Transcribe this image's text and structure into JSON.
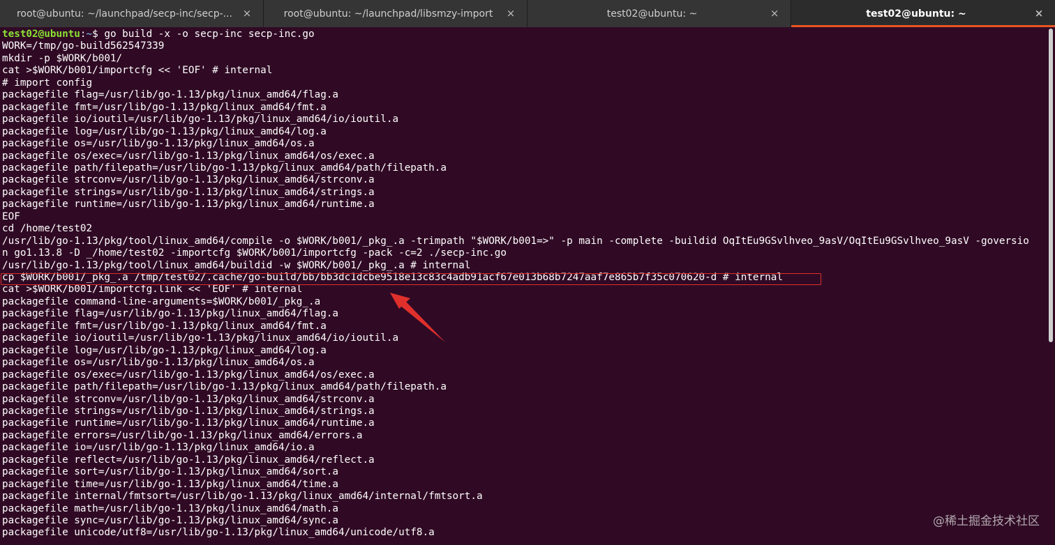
{
  "tabs": [
    {
      "title": "root@ubuntu: ~/launchpad/secp-inc/secp-...",
      "close": "×",
      "active": false
    },
    {
      "title": "root@ubuntu: ~/launchpad/libsmzy-import",
      "close": "×",
      "active": false
    },
    {
      "title": "test02@ubuntu: ~",
      "close": "×",
      "active": false
    },
    {
      "title": "test02@ubuntu: ~",
      "close": "×",
      "active": true
    }
  ],
  "terminal": {
    "prompt_user": "test02@ubuntu",
    "prompt_sep": ":",
    "prompt_path": "~",
    "prompt_symbol": "$ ",
    "command": "go build -x -o secp-inc secp-inc.go",
    "lines": [
      "WORK=/tmp/go-build562547339",
      "mkdir -p $WORK/b001/",
      "cat >$WORK/b001/importcfg << 'EOF' # internal",
      "# import config",
      "packagefile flag=/usr/lib/go-1.13/pkg/linux_amd64/flag.a",
      "packagefile fmt=/usr/lib/go-1.13/pkg/linux_amd64/fmt.a",
      "packagefile io/ioutil=/usr/lib/go-1.13/pkg/linux_amd64/io/ioutil.a",
      "packagefile log=/usr/lib/go-1.13/pkg/linux_amd64/log.a",
      "packagefile os=/usr/lib/go-1.13/pkg/linux_amd64/os.a",
      "packagefile os/exec=/usr/lib/go-1.13/pkg/linux_amd64/os/exec.a",
      "packagefile path/filepath=/usr/lib/go-1.13/pkg/linux_amd64/path/filepath.a",
      "packagefile strconv=/usr/lib/go-1.13/pkg/linux_amd64/strconv.a",
      "packagefile strings=/usr/lib/go-1.13/pkg/linux_amd64/strings.a",
      "packagefile runtime=/usr/lib/go-1.13/pkg/linux_amd64/runtime.a",
      "EOF",
      "cd /home/test02",
      "/usr/lib/go-1.13/pkg/tool/linux_amd64/compile -o $WORK/b001/_pkg_.a -trimpath \"$WORK/b001=>\" -p main -complete -buildid OqItEu9GSvlhveo_9asV/OqItEu9GSvlhveo_9asV -goversio",
      "n go1.13.8 -D _/home/test02 -importcfg $WORK/b001/importcfg -pack -c=2 ./secp-inc.go",
      "/usr/lib/go-1.13/pkg/tool/linux_amd64/buildid -w $WORK/b001/_pkg_.a # internal",
      "cp $WORK/b001/_pkg_.a /tmp/test02/.cache/go-build/bb/bb3dc1dcbe9518e13c83c4adb91acf67e013b68b7247aaf7e865b7f35c070620-d # internal",
      "cat >$WORK/b001/importcfg.link << 'EOF' # internal",
      "packagefile command-line-arguments=$WORK/b001/_pkg_.a",
      "packagefile flag=/usr/lib/go-1.13/pkg/linux_amd64/flag.a",
      "packagefile fmt=/usr/lib/go-1.13/pkg/linux_amd64/fmt.a",
      "packagefile io/ioutil=/usr/lib/go-1.13/pkg/linux_amd64/io/ioutil.a",
      "packagefile log=/usr/lib/go-1.13/pkg/linux_amd64/log.a",
      "packagefile os=/usr/lib/go-1.13/pkg/linux_amd64/os.a",
      "packagefile os/exec=/usr/lib/go-1.13/pkg/linux_amd64/os/exec.a",
      "packagefile path/filepath=/usr/lib/go-1.13/pkg/linux_amd64/path/filepath.a",
      "packagefile strconv=/usr/lib/go-1.13/pkg/linux_amd64/strconv.a",
      "packagefile strings=/usr/lib/go-1.13/pkg/linux_amd64/strings.a",
      "packagefile runtime=/usr/lib/go-1.13/pkg/linux_amd64/runtime.a",
      "packagefile errors=/usr/lib/go-1.13/pkg/linux_amd64/errors.a",
      "packagefile io=/usr/lib/go-1.13/pkg/linux_amd64/io.a",
      "packagefile reflect=/usr/lib/go-1.13/pkg/linux_amd64/reflect.a",
      "packagefile sort=/usr/lib/go-1.13/pkg/linux_amd64/sort.a",
      "packagefile time=/usr/lib/go-1.13/pkg/linux_amd64/time.a",
      "packagefile internal/fmtsort=/usr/lib/go-1.13/pkg/linux_amd64/internal/fmtsort.a",
      "packagefile math=/usr/lib/go-1.13/pkg/linux_amd64/math.a",
      "packagefile sync=/usr/lib/go-1.13/pkg/linux_amd64/sync.a",
      "packagefile unicode/utf8=/usr/lib/go-1.13/pkg/linux_amd64/unicode/utf8.a"
    ]
  },
  "colors": {
    "background": "#300a24",
    "prompt_user": "#8ae234",
    "prompt_path": "#729fcf",
    "highlight": "#e0302c",
    "tab_accent": "#e95420"
  },
  "watermark": "@稀土掘金技术社区"
}
